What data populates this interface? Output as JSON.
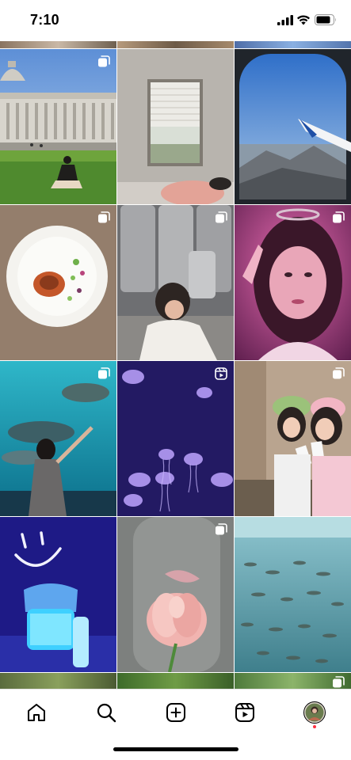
{
  "status_bar": {
    "time": "7:10",
    "icons": [
      "cellular-signal-icon",
      "wifi-icon",
      "battery-icon"
    ]
  },
  "explore_grid": {
    "tiles": [
      {
        "row": 1,
        "col": 1,
        "subject": "capitol-building",
        "badge": "carousel-icon"
      },
      {
        "row": 1,
        "col": 2,
        "subject": "bedroom-window",
        "badge": ""
      },
      {
        "row": 1,
        "col": 3,
        "subject": "airplane-window-view",
        "badge": ""
      },
      {
        "row": 2,
        "col": 1,
        "subject": "plated-dish",
        "badge": "carousel-icon"
      },
      {
        "row": 2,
        "col": 2,
        "subject": "kegs-portrait",
        "badge": "carousel-icon"
      },
      {
        "row": 2,
        "col": 3,
        "subject": "selfie-pink-light",
        "badge": "carousel-icon"
      },
      {
        "row": 3,
        "col": 1,
        "subject": "aquarium-turtle",
        "badge": "carousel-icon"
      },
      {
        "row": 3,
        "col": 2,
        "subject": "jellyfish",
        "badge": "reels-icon"
      },
      {
        "row": 3,
        "col": 3,
        "subject": "photobooth-friends",
        "badge": "carousel-icon"
      },
      {
        "row": 4,
        "col": 1,
        "subject": "neon-smiley-jar",
        "badge": ""
      },
      {
        "row": 4,
        "col": 2,
        "subject": "pink-tulip",
        "badge": "carousel-icon"
      },
      {
        "row": 4,
        "col": 3,
        "subject": "fish-school",
        "badge": ""
      }
    ]
  },
  "bottom_nav": {
    "items": [
      "home-icon",
      "search-icon",
      "create-icon",
      "reels-icon",
      "profile-avatar"
    ],
    "active": "profile-avatar"
  },
  "colors": {
    "notification_dot": "#ff3040",
    "icon": "#000000"
  }
}
